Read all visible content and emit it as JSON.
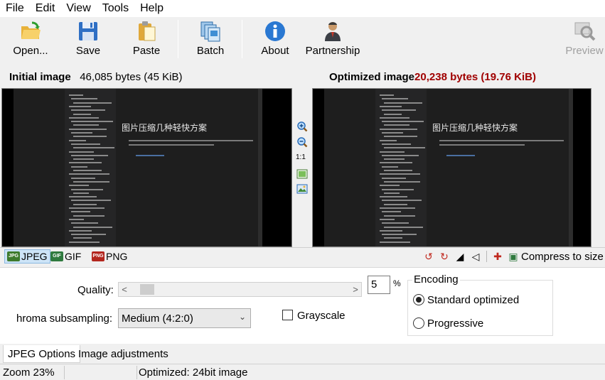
{
  "menu": [
    "File",
    "Edit",
    "View",
    "Tools",
    "Help"
  ],
  "toolbar": {
    "open": "Open...",
    "save": "Save",
    "paste": "Paste",
    "batch": "Batch",
    "about": "About",
    "partnership": "Partnership",
    "preview": "Preview"
  },
  "initial": {
    "label": "Initial image",
    "size": "46,085 bytes (45 KiB)"
  },
  "optimized": {
    "label": "Optimized image",
    "size": "20,238 bytes (19.76 KiB)"
  },
  "preview_doc_title": "图片压缩几种轻快方案",
  "zoom_bar": {
    "one_to_one": "1:1"
  },
  "formats": {
    "jpeg": "JPEG",
    "gif": "GIF",
    "png": "PNG",
    "selected": "JPEG"
  },
  "compress_to_size": "Compress to size",
  "jpeg_options": {
    "quality_label": "Quality:",
    "quality_value": "5",
    "quality_unit": "%",
    "chroma_label": "hroma subsampling:",
    "chroma_value": "Medium (4:2:0)",
    "grayscale_label": "Grayscale",
    "grayscale_checked": false,
    "encoding_label": "Encoding",
    "encoding_options": [
      "Standard optimized",
      "Progressive"
    ],
    "encoding_selected": "Standard optimized"
  },
  "bottom_tabs": [
    "JPEG Options",
    "Image adjustments"
  ],
  "status": {
    "zoom": "Zoom 23%",
    "info": "Optimized: 24bit  image"
  },
  "colors": {
    "size_red": "#a00000",
    "tab_selected": "#cde4f7"
  }
}
